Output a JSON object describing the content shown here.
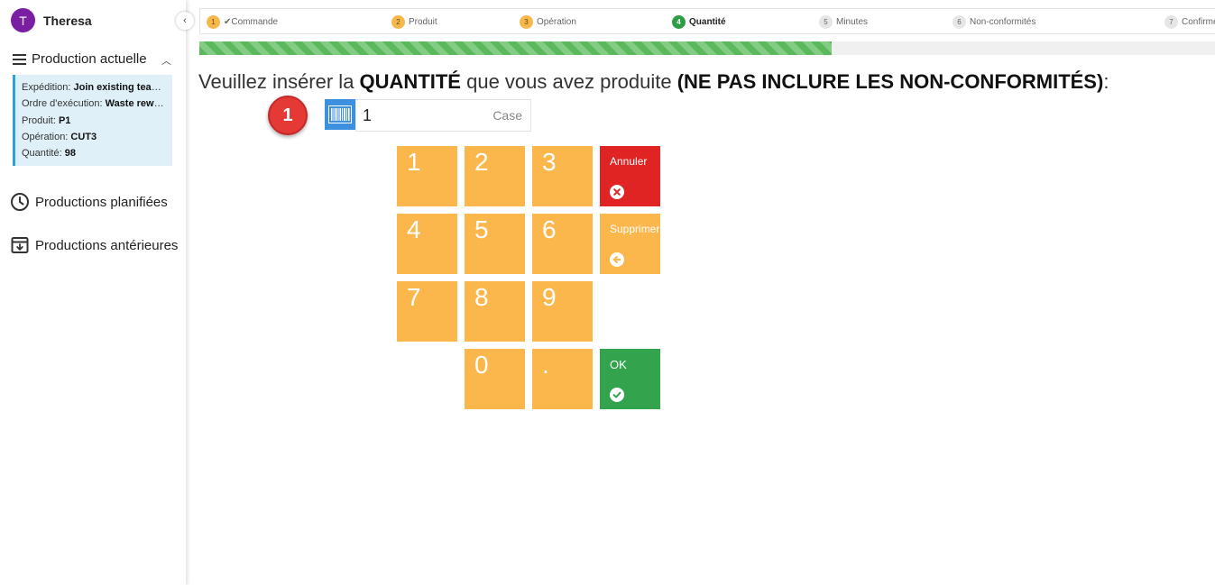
{
  "user": {
    "initial": "T",
    "name": "Theresa"
  },
  "sidebar": {
    "current_title": "Production actuelle",
    "info": [
      {
        "label": "Expédition: ",
        "value": "Join existing team…"
      },
      {
        "label": "Ordre d'exécution: ",
        "value": "Waste rewo…"
      },
      {
        "label": "Produit: ",
        "value": "P1"
      },
      {
        "label": "Opération: ",
        "value": "CUT3"
      },
      {
        "label": "Quantité: ",
        "value": "98"
      }
    ],
    "planned_label": "Productions planifiées",
    "previous_label": "Productions antérieures"
  },
  "steps": [
    {
      "num": "1",
      "label": "✔Commande",
      "state": "done"
    },
    {
      "num": "2",
      "label": "Produit",
      "state": "done"
    },
    {
      "num": "3",
      "label": "Opération",
      "state": "done"
    },
    {
      "num": "4",
      "label": "Quantité",
      "state": "active"
    },
    {
      "num": "5",
      "label": "Minutes",
      "state": "todo"
    },
    {
      "num": "6",
      "label": "Non-conformités",
      "state": "todo"
    },
    {
      "num": "7",
      "label": "Confirme",
      "state": "todo"
    }
  ],
  "progress": {
    "percent": 62
  },
  "prompt": {
    "part1": "Veuillez insérer la ",
    "bold1": "QUANTITÉ",
    "part2": " que vous avez produite ",
    "bold2": "(NE PAS INCLURE LES NON-CONFORMITÉS)",
    "part3": ":"
  },
  "badge": "1",
  "quantity": {
    "value": "1",
    "unit": "Case"
  },
  "keypad": {
    "digits": [
      "1",
      "2",
      "3",
      "4",
      "5",
      "6",
      "7",
      "8",
      "9",
      "0",
      "."
    ],
    "cancel_label": "Annuler",
    "delete_label": "Supprimer",
    "ok_label": "OK"
  },
  "colors": {
    "accent": "#2e9e44",
    "numpad": "#fbb74b",
    "cancel": "#e02424",
    "ok": "#33a34d",
    "avatar": "#7b1fa2"
  }
}
